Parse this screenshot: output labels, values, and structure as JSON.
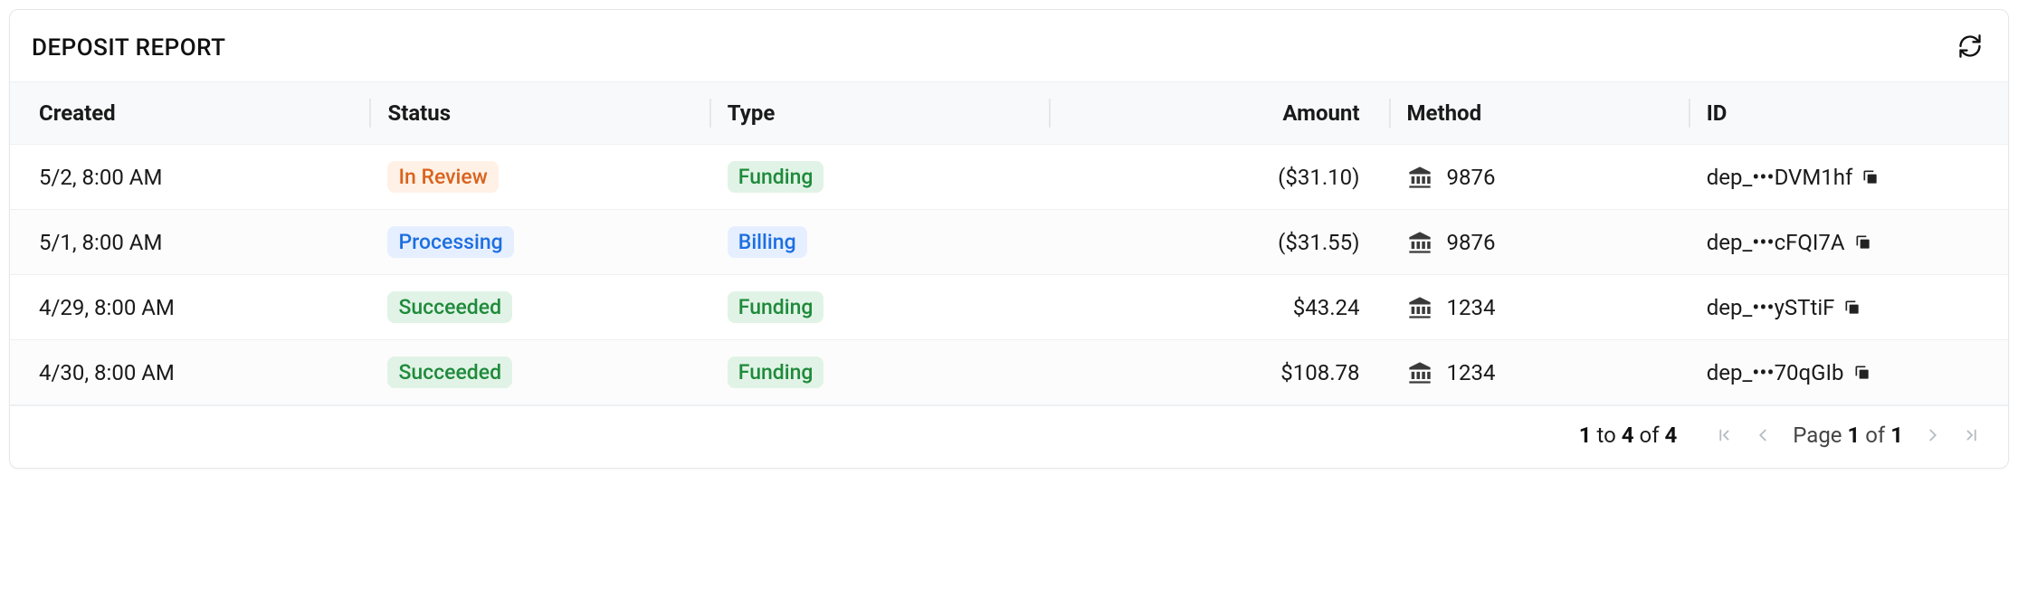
{
  "header": {
    "title": "DEPOSIT REPORT"
  },
  "columns": {
    "created": "Created",
    "status": "Status",
    "type": "Type",
    "amount": "Amount",
    "method": "Method",
    "id": "ID"
  },
  "rows": [
    {
      "created": "5/2, 8:00 AM",
      "status": {
        "label": "In Review",
        "variant": "orange"
      },
      "type": {
        "label": "Funding",
        "variant": "green"
      },
      "amount": "($31.10)",
      "method": "9876",
      "id": "dep_•••DVM1hf"
    },
    {
      "created": "5/1, 8:00 AM",
      "status": {
        "label": "Processing",
        "variant": "blue"
      },
      "type": {
        "label": "Billing",
        "variant": "blue"
      },
      "amount": "($31.55)",
      "method": "9876",
      "id": "dep_•••cFQI7A"
    },
    {
      "created": "4/29, 8:00 AM",
      "status": {
        "label": "Succeeded",
        "variant": "green"
      },
      "type": {
        "label": "Funding",
        "variant": "green"
      },
      "amount": "$43.24",
      "method": "1234",
      "id": "dep_•••ySTtiF"
    },
    {
      "created": "4/30, 8:00 AM",
      "status": {
        "label": "Succeeded",
        "variant": "green"
      },
      "type": {
        "label": "Funding",
        "variant": "green"
      },
      "amount": "$108.78",
      "method": "1234",
      "id": "dep_•••70qGIb"
    }
  ],
  "footer": {
    "range_from": "1",
    "range_to": "4",
    "range_total": "4",
    "range_to_word": "to",
    "range_of_word": "of",
    "page_word": "Page",
    "page_current": "1",
    "page_of_word": "of",
    "page_total": "1"
  }
}
